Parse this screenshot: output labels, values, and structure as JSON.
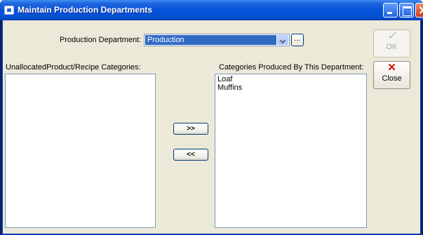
{
  "window": {
    "title": "Maintain Production Departments",
    "icons": [
      "app-icon",
      "minimize-icon",
      "maximize-icon",
      "close-window-icon"
    ]
  },
  "department": {
    "label": "Production Department:",
    "selected": "Production",
    "ellipsis_label": "..."
  },
  "buttons": {
    "ok_label": "OK",
    "ok_icon": "checkmark-icon",
    "close_label": "Close",
    "close_icon": "red-x-icon",
    "move_right_label": ">>",
    "move_left_label": "<<"
  },
  "lists": {
    "unallocated_label": "UnallocatedProduct/Recipe Categories:",
    "unallocated_items": [],
    "produced_label": "Categories Produced By This Department:",
    "produced_items": [
      "Loaf",
      "Muffins"
    ]
  },
  "colors": {
    "title_bar": "#0553dc",
    "selection": "#316ac5",
    "close_x": "#d01010",
    "dialog_bg": "#ece9d8"
  }
}
